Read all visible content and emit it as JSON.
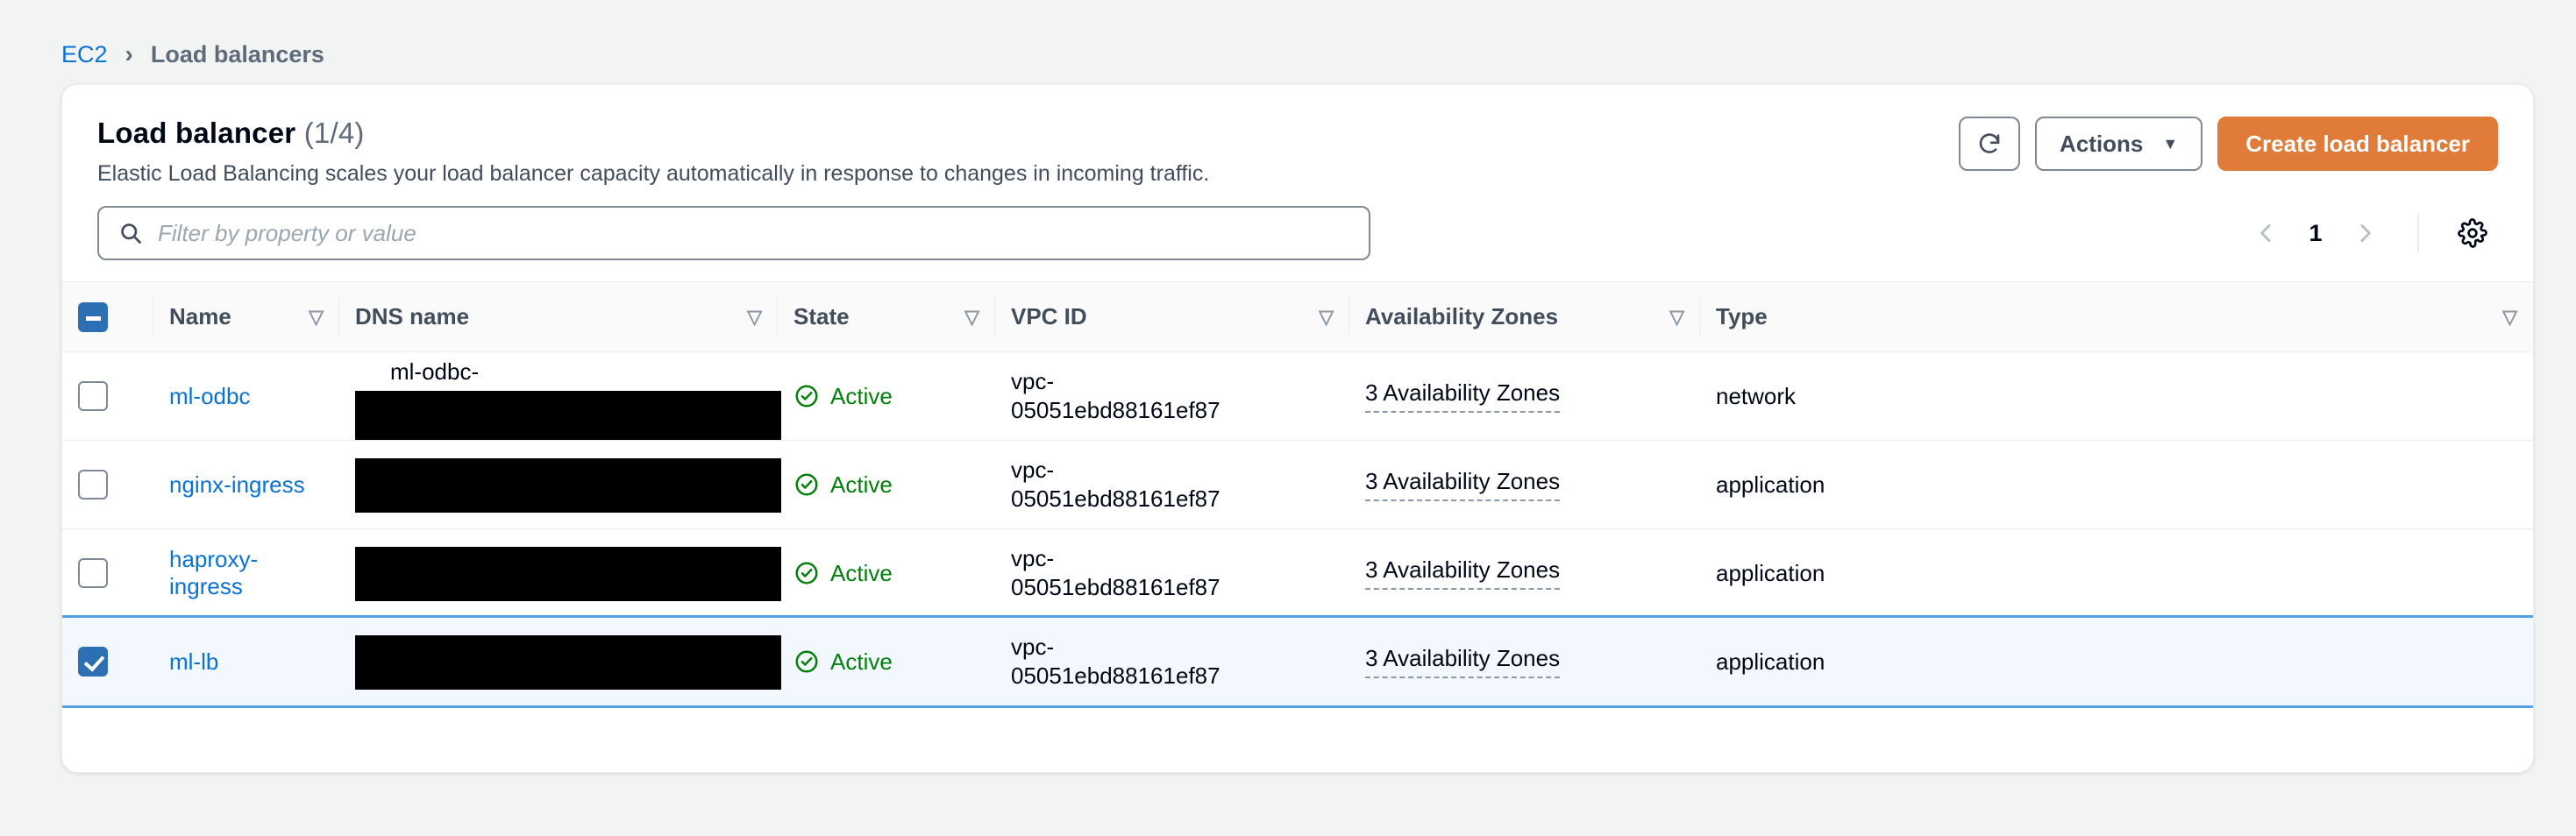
{
  "breadcrumb": {
    "root": "EC2",
    "separator": "›",
    "current": "Load balancers"
  },
  "panel": {
    "title": "Load balancer",
    "count": "(1/4)",
    "description": "Elastic Load Balancing scales your load balancer capacity automatically in response to changes in incoming traffic.",
    "refresh_icon": "refresh-icon",
    "actions_label": "Actions",
    "actions_caret": "▼",
    "create_label": "Create load balancer",
    "primary_color": "#e07b39"
  },
  "search": {
    "icon": "search-icon",
    "placeholder": "Filter by property or value",
    "value": ""
  },
  "pagination": {
    "prev_icon": "chevron-left-icon",
    "page": "1",
    "next_icon": "chevron-right-icon",
    "settings_icon": "gear-icon"
  },
  "table": {
    "select_all_state": "indeterminate",
    "sort_icon": "▽",
    "columns": [
      {
        "key": "name",
        "label": "Name"
      },
      {
        "key": "dns",
        "label": "DNS name"
      },
      {
        "key": "state",
        "label": "State"
      },
      {
        "key": "vpc",
        "label": "VPC ID"
      },
      {
        "key": "az",
        "label": "Availability Zones"
      },
      {
        "key": "type",
        "label": "Type"
      }
    ],
    "rows": [
      {
        "selected": false,
        "name": "ml-odbc",
        "dns_visible": "ml-odbc-",
        "dns_redacted": true,
        "state": "Active",
        "state_icon": "check-circle-icon",
        "vpc_line1": "vpc-",
        "vpc_line2": "05051ebd88161ef87",
        "az": "3 Availability Zones",
        "type": "network"
      },
      {
        "selected": false,
        "name": "nginx-ingress",
        "dns_visible": "",
        "dns_redacted": true,
        "state": "Active",
        "state_icon": "check-circle-icon",
        "vpc_line1": "vpc-",
        "vpc_line2": "05051ebd88161ef87",
        "az": "3 Availability Zones",
        "type": "application"
      },
      {
        "selected": false,
        "name": "haproxy-ingress",
        "dns_visible": "",
        "dns_redacted": true,
        "state": "Active",
        "state_icon": "check-circle-icon",
        "vpc_line1": "vpc-",
        "vpc_line2": "05051ebd88161ef87",
        "az": "3 Availability Zones",
        "type": "application"
      },
      {
        "selected": true,
        "name": "ml-lb",
        "dns_visible": "",
        "dns_redacted": true,
        "state": "Active",
        "state_icon": "check-circle-icon",
        "vpc_line1": "vpc-",
        "vpc_line2": "05051ebd88161ef87",
        "az": "3 Availability Zones",
        "type": "application"
      }
    ]
  }
}
